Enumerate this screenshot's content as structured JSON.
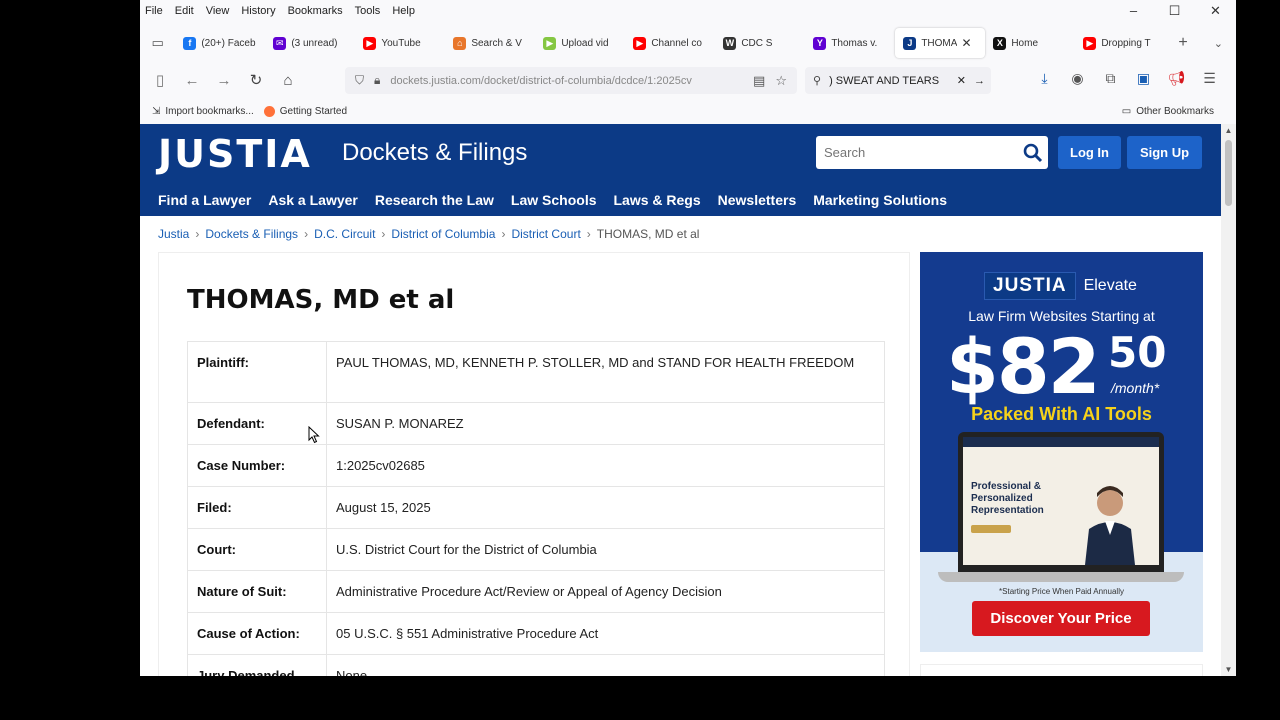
{
  "menubar": {
    "items": [
      "File",
      "Edit",
      "View",
      "History",
      "Bookmarks",
      "Tools",
      "Help"
    ],
    "window_controls": [
      "–",
      "☐",
      "✕"
    ]
  },
  "tabs": [
    {
      "label": "(20+) Faceb",
      "icon": "facebook-icon",
      "color": "#1877f2",
      "glyph": "f"
    },
    {
      "label": "(3 unread)",
      "icon": "yahoo-mail-icon",
      "color": "#6001d2",
      "glyph": "✉"
    },
    {
      "label": "YouTube",
      "icon": "youtube-icon",
      "color": "#ff0000",
      "glyph": "▶"
    },
    {
      "label": "Search & V",
      "icon": "search-folder-icon",
      "color": "#e8762b",
      "glyph": "⌂"
    },
    {
      "label": "Upload vid",
      "icon": "rumble-icon",
      "color": "#85c742",
      "glyph": "▶"
    },
    {
      "label": "Channel co",
      "icon": "youtube-icon",
      "color": "#ff0000",
      "glyph": "▶"
    },
    {
      "label": "CDC S",
      "icon": "audio-icon",
      "color": "#333333",
      "glyph": "W"
    },
    {
      "label": "Thomas v.",
      "icon": "yahoo-icon",
      "color": "#6001d2",
      "glyph": "Y"
    },
    {
      "label": "THOMA",
      "icon": "justia-icon",
      "color": "#0c3a86",
      "glyph": "J",
      "active": true
    },
    {
      "label": "Home",
      "icon": "x-icon",
      "color": "#111111",
      "glyph": "X"
    },
    {
      "label": "Dropping T",
      "icon": "youtube-icon",
      "color": "#ff0000",
      "glyph": "▶"
    }
  ],
  "navbar": {
    "url": "dockets.justia.com/docket/district-of-columbia/dcdce/1:2025cv",
    "find_text": ") SWEAT AND TEARS"
  },
  "bookmarks": {
    "import": "Import bookmarks...",
    "getting_started": "Getting Started",
    "other": "Other Bookmarks"
  },
  "site": {
    "logo": "JUSTIA",
    "logo_sub": "Dockets & Filings",
    "search_placeholder": "Search",
    "login": "Log In",
    "signup": "Sign Up",
    "nav": [
      "Find a Lawyer",
      "Ask a Lawyer",
      "Research the Law",
      "Law Schools",
      "Laws & Regs",
      "Newsletters",
      "Marketing Solutions"
    ]
  },
  "breadcrumb": [
    "Justia",
    "Dockets & Filings",
    "D.C. Circuit",
    "District of Columbia",
    "District Court"
  ],
  "breadcrumb_current": "THOMAS, MD et al",
  "case": {
    "title": "THOMAS, MD et al",
    "rows": [
      {
        "label": "Plaintiff:",
        "value": "PAUL THOMAS, MD, KENNETH P. STOLLER, MD and STAND FOR HEALTH FREEDOM"
      },
      {
        "label": "Defendant:",
        "value": "SUSAN P. MONAREZ"
      },
      {
        "label": "Case Number:",
        "value": "1:2025cv02685"
      },
      {
        "label": "Filed:",
        "value": "August 15, 2025"
      },
      {
        "label": "Court:",
        "value": "U.S. District Court for the District of Columbia"
      },
      {
        "label": "Nature of Suit:",
        "value": "Administrative Procedure Act/Review or Appeal of Agency Decision"
      },
      {
        "label": "Cause of Action:",
        "value": "05 U.S.C. § 551 Administrative Procedure Act"
      },
      {
        "label": "Jury Demanded",
        "value": "None"
      }
    ]
  },
  "ad": {
    "brand": "JUSTIA",
    "product": "Elevate",
    "subtitle": "Law Firm Websites Starting at",
    "price": "$82",
    "cents": "50",
    "per": "/month*",
    "tagline": "Packed With AI Tools",
    "screen_text": "Professional & Personalized Representation",
    "fine_print": "*Starting Price When Paid Annually",
    "cta": "Discover Your Price"
  }
}
